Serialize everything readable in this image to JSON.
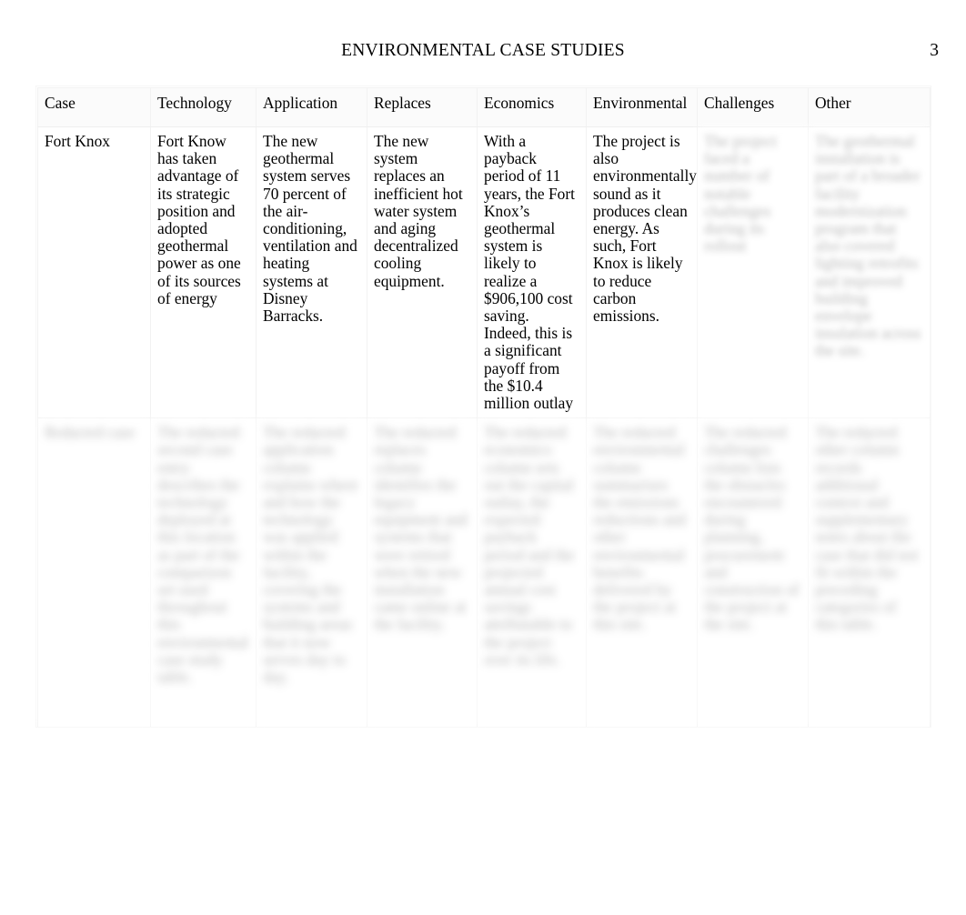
{
  "document": {
    "running_header": "ENVIRONMENTAL CASE STUDIES",
    "page_number": "3"
  },
  "table": {
    "columns": [
      "Case",
      "Technology",
      "Application",
      "Replaces",
      "Economics",
      "Environmental",
      "Challenges",
      "Other"
    ],
    "rows": [
      {
        "case": "Fort Knox",
        "technology": "Fort Know has taken advantage of its strategic position and adopted geothermal power as one of its sources of energy",
        "application": "The new geothermal system serves 70 percent of the air-conditioning, ventilation and heating systems at Disney Barracks.",
        "replaces": "The new system replaces an inefficient hot water system and aging decentralized cooling equipment.",
        "economics": "With a payback period of 11 years, the Fort Knox’s geothermal system is likely to realize a $906,100 cost saving. Indeed, this is a significant payoff from the $10.4 million outlay",
        "environmental": "The project is also environmentally sound as it produces clean energy. As such, Fort Knox is likely to reduce carbon emissions.",
        "challenges": "The project faced a number of notable challenges during its rollout",
        "other": "The geothermal installation is part of a broader facility modernization program that also covered lighting retrofits and improved building envelope insulation across the site."
      },
      {
        "case": "Redacted case",
        "technology": "The redacted second case entry describes the technology deployed at this location as part of the comparison set used throughout this environmental case study table.",
        "application": "The redacted application column explains where and how the technology was applied within the facility, covering the systems and building areas that it now serves day to day.",
        "replaces": "The redacted replaces column identifies the legacy equipment and systems that were retired when the new installation came online at the facility.",
        "economics": "The redacted economics column sets out the capital outlay, the expected payback period and the projected annual cost savings attributable to the project over its life.",
        "environmental": "The redacted environmental column summarises the emissions reductions and other environmental benefits delivered by the project at this site.",
        "challenges": "The redacted challenges column lists the obstacles encountered during planning, procurement and construction of the project at the site.",
        "other": "The redacted other column records additional context and supplementary notes about the case that did not fit within the preceding categories of this table."
      }
    ]
  }
}
